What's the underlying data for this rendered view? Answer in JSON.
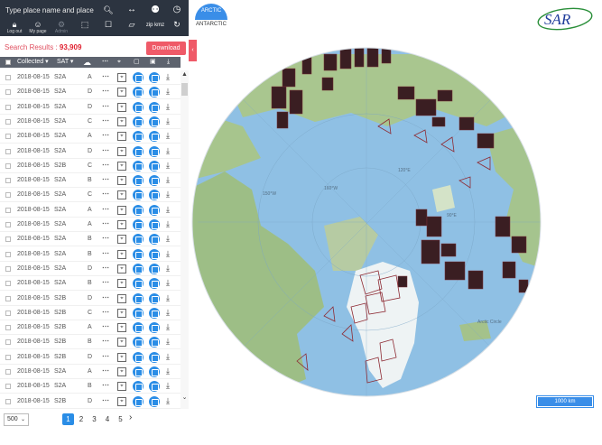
{
  "search": {
    "placeholder": "Type place name and place"
  },
  "toolbar": {
    "logout_label": "Log out",
    "mypage_label": "My page",
    "admin_label": "Admin",
    "kmz_label": "zip kmz"
  },
  "results": {
    "label": "Search Results : ",
    "count": "93,909",
    "download_label": "Download"
  },
  "table": {
    "headers": {
      "collected": "Collected",
      "sat": "SAT"
    },
    "rows": [
      {
        "date": "2018-08-15",
        "sat": "S2A",
        "code": "A"
      },
      {
        "date": "2018-08-15",
        "sat": "S2A",
        "code": "D"
      },
      {
        "date": "2018-08-15",
        "sat": "S2A",
        "code": "D"
      },
      {
        "date": "2018-08-15",
        "sat": "S2A",
        "code": "C"
      },
      {
        "date": "2018-08-15",
        "sat": "S2A",
        "code": "A"
      },
      {
        "date": "2018-08-15",
        "sat": "S2A",
        "code": "D"
      },
      {
        "date": "2018-08-15",
        "sat": "S2B",
        "code": "C"
      },
      {
        "date": "2018-08-15",
        "sat": "S2A",
        "code": "B"
      },
      {
        "date": "2018-08-15",
        "sat": "S2A",
        "code": "C"
      },
      {
        "date": "2018-08-15",
        "sat": "S2A",
        "code": "A"
      },
      {
        "date": "2018-08-15",
        "sat": "S2A",
        "code": "A"
      },
      {
        "date": "2018-08-15",
        "sat": "S2A",
        "code": "B"
      },
      {
        "date": "2018-08-15",
        "sat": "S2A",
        "code": "B"
      },
      {
        "date": "2018-08-15",
        "sat": "S2A",
        "code": "D"
      },
      {
        "date": "2018-08-15",
        "sat": "S2A",
        "code": "B"
      },
      {
        "date": "2018-08-15",
        "sat": "S2B",
        "code": "D"
      },
      {
        "date": "2018-08-15",
        "sat": "S2B",
        "code": "C"
      },
      {
        "date": "2018-08-15",
        "sat": "S2B",
        "code": "A"
      },
      {
        "date": "2018-08-15",
        "sat": "S2B",
        "code": "B"
      },
      {
        "date": "2018-08-15",
        "sat": "S2B",
        "code": "D"
      },
      {
        "date": "2018-08-15",
        "sat": "S2A",
        "code": "A"
      },
      {
        "date": "2018-08-15",
        "sat": "S2A",
        "code": "B"
      },
      {
        "date": "2018-08-15",
        "sat": "S2B",
        "code": "D"
      }
    ]
  },
  "pagination": {
    "per_page": "500",
    "pages": [
      "1",
      "2",
      "3",
      "4",
      "5"
    ],
    "active_page": "1"
  },
  "map": {
    "tabs": {
      "arctic": "ARCTIC",
      "antarctic": "ANTARCTIC"
    },
    "scale_label": "1000 km",
    "logo_text": "SAR"
  },
  "colors": {
    "topbar": "#2c3440",
    "accent_blue": "#2a8de6",
    "download_red": "#ef5a68",
    "ocean": "#8fc0e4",
    "land": "#9cbf8a",
    "footprint": "#3a1e22"
  }
}
